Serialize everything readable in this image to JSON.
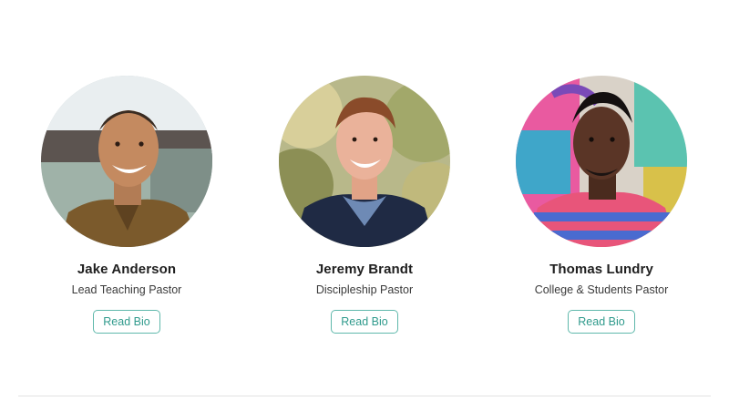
{
  "staff": [
    {
      "name": "Jake Anderson",
      "role": "Lead Teaching Pastor",
      "button_label": "Read Bio"
    },
    {
      "name": "Jeremy Brandt",
      "role": "Discipleship Pastor",
      "button_label": "Read Bio"
    },
    {
      "name": "Thomas Lundry",
      "role": "College & Students Pastor",
      "button_label": "Read Bio"
    }
  ],
  "colors": {
    "accent": "#2f9a8c",
    "button_border": "#5fb8ab",
    "name_text": "#1f1f1f",
    "role_text": "#3a3a3a",
    "divider": "#e2e2e2"
  }
}
